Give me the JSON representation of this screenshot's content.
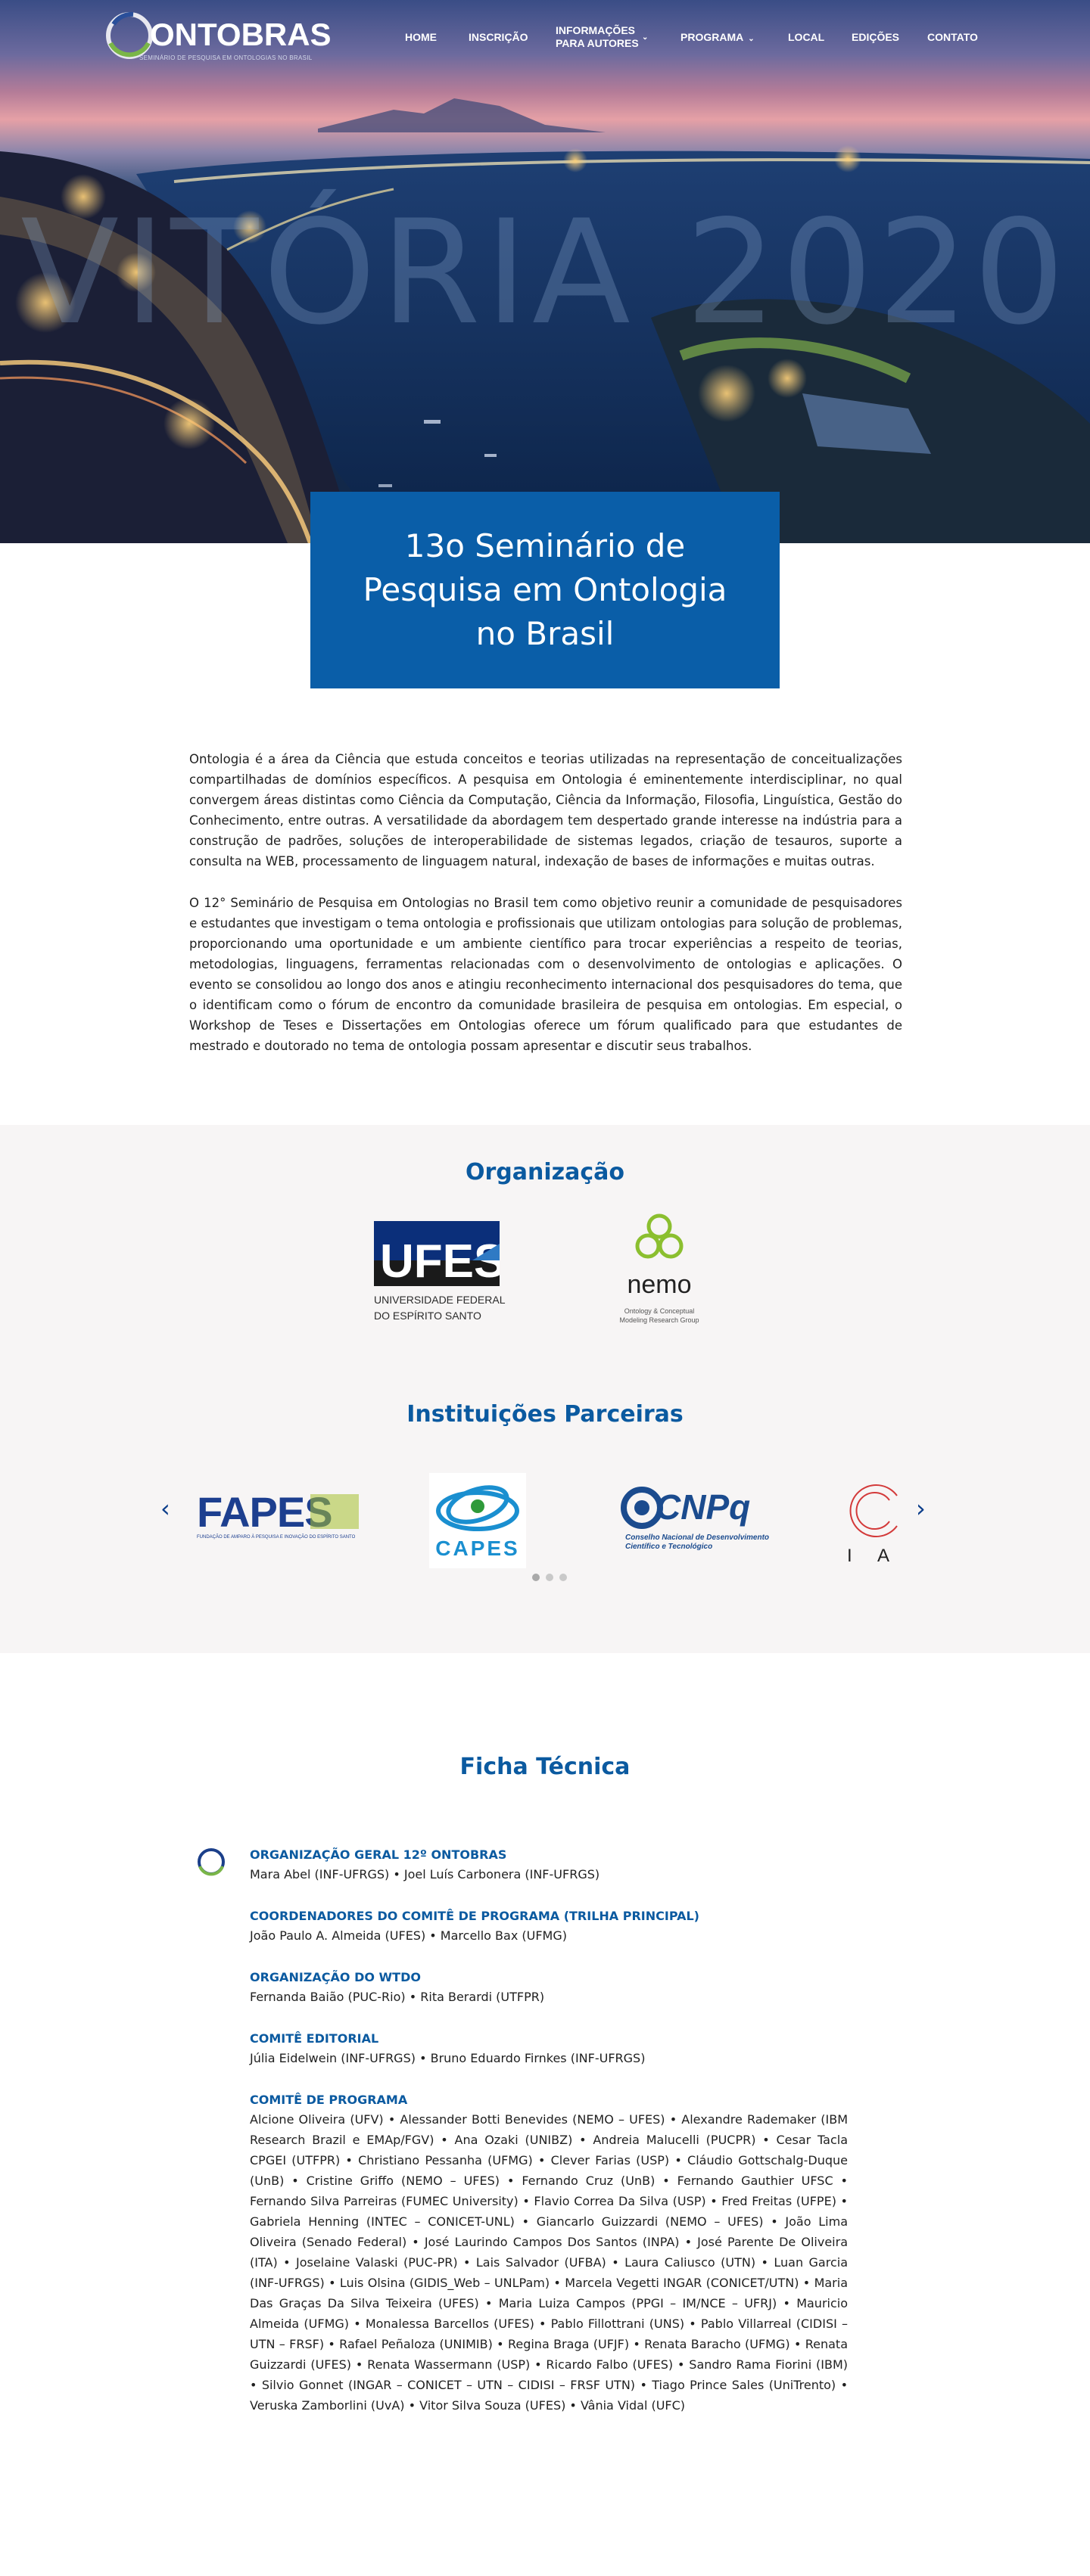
{
  "nav": {
    "brand": "ONTOBRAS",
    "tagline": "SEMINÁRIO DE PESQUISA EM ONTOLOGIAS NO BRASIL",
    "items": [
      {
        "label": "HOME"
      },
      {
        "label": "INSCRIÇÃO"
      },
      {
        "label_line1": "INFORMAÇÕES",
        "label_line2": "PARA AUTORES",
        "dropdown": true
      },
      {
        "label": "PROGRAMA",
        "dropdown": true
      },
      {
        "label": "LOCAL"
      },
      {
        "label": "EDIÇÕES"
      },
      {
        "label": "CONTATO"
      }
    ]
  },
  "hero": {
    "watermark": "VITÓRIA 2020",
    "title": "13o Seminário de Pesquisa em Ontologia no Brasil"
  },
  "intro": {
    "p1": "Ontologia é a área da Ciência que estuda conceitos e teorias utilizadas na representação de conceitualizações compartilhadas de domínios específicos. A pesquisa em Ontologia é eminentemente interdisciplinar, no qual convergem áreas distintas como Ciência da Computação, Ciência da Informação, Filosofia, Linguística, Gestão do Conhecimento, entre outras. A versatilidade da abordagem tem despertado grande interesse na indústria para a construção de padrões, soluções de interoperabilidade de sistemas legados, criação de tesauros, suporte a consulta na WEB, processamento de linguagem natural, indexação de bases de informações e muitas outras.",
    "p2": "O 12° Seminário de Pesquisa em Ontologias no Brasil tem como objetivo reunir a comunidade de pesquisadores e estudantes que investigam o tema ontologia e profissionais que utilizam ontologias para solução de problemas, proporcionando uma oportunidade e um ambiente científico para trocar experiências a respeito de teorias, metodologias, linguagens, ferramentas relacionadas com o desenvolvimento de ontologias e aplicações. O evento se consolidou ao longo dos anos e atingiu reconhecimento internacional dos pesquisadores do tema, que o identificam como o fórum de encontro da comunidade brasileira de pesquisa em ontologias. Em especial, o Workshop de Teses e Dissertações em Ontologias oferece um fórum qualificado para que estudantes de mestrado e doutorado no tema de ontologia possam apresentar e discutir seus trabalhos."
  },
  "organizacao": {
    "title": "Organização",
    "ufes": {
      "logo_text": "UFES",
      "caption_line1": "UNIVERSIDADE FEDERAL",
      "caption_line2": "DO ESPÍRITO SANTO"
    },
    "nemo": {
      "logo_text": "nemo",
      "sub_line1": "Ontology & Conceptual",
      "sub_line2": "Modeling Research Group"
    }
  },
  "parceiras": {
    "title": "Instituições Parceiras",
    "prev_icon": "chevron-left-icon",
    "next_icon": "chevron-right-icon",
    "logos": [
      {
        "text": "FAPES",
        "sub": "FUNDAÇÃO DE AMPARO À PESQUISA E INOVAÇÃO DO ESPÍRITO SANTO"
      },
      {
        "text": "CAPES"
      },
      {
        "text": "CNPq",
        "sub_line1": "Conselho Nacional de Desenvolvimento",
        "sub_line2": "Científico e Tecnológico"
      },
      {
        "text": "I A"
      }
    ],
    "dots": 3
  },
  "ficha": {
    "title": "Ficha Técnica",
    "groups": [
      {
        "heading": "ORGANIZAÇÃO GERAL 12º ONTOBRAS",
        "text": "Mara Abel (INF-UFRGS)  •  Joel Luís Carbonera (INF-UFRGS)"
      },
      {
        "heading": "COORDENADORES DO COMITÊ DE PROGRAMA (TRILHA PRINCIPAL)",
        "text": "João Paulo A. Almeida (UFES)  •  Marcello Bax (UFMG)"
      },
      {
        "heading": "ORGANIZAÇÃO DO WTDO",
        "text": "Fernanda Baião (PUC-Rio)  •  Rita Berardi (UTFPR)"
      },
      {
        "heading": "COMITÊ EDITORIAL",
        "text": "Júlia Eidelwein (INF-UFRGS)   •  Bruno Eduardo Firnkes (INF-UFRGS)"
      },
      {
        "heading": "COMITÊ DE PROGRAMA",
        "text": "Alcione Oliveira (UFV)  •  Alessander Botti Benevides (NEMO – UFES)  •  Alexandre Rademaker (IBM Research Brazil e EMAp/FGV)  •  Ana Ozaki (UNIBZ)  •  Andreia Malucelli (PUCPR)  •  Cesar Tacla CPGEI (UTFPR)  •  Christiano Pessanha (UFMG)  •  Clever Farias (USP)  •  Cláudio Gottschalg-Duque (UnB)  •  Cristine Griffo (NEMO – UFES)  •  Fernando Cruz (UnB)  •  Fernando Gauthier UFSC  •  Fernando Silva Parreiras (FUMEC University)  •  Flavio Correa Da Silva (USP)  •  Fred Freitas (UFPE)  •  Gabriela Henning (INTEC – CONICET-UNL)  •  Giancarlo Guizzardi (NEMO – UFES)  •  João Lima Oliveira (Senado Federal)  •  José Laurindo Campos Dos Santos (INPA)  •  José Parente De Oliveira (ITA)  •  Joselaine Valaski (PUC-PR)  •  Lais Salvador (UFBA)  •  Laura Caliusco (UTN)  •  Luan Garcia (INF-UFRGS)  •  Luis Olsina (GIDIS_Web – UNLPam)  •  Marcela Vegetti INGAR (CONICET/UTN)  •  Maria Das Graças Da Silva Teixeira (UFES)  •  Maria Luiza Campos (PPGI – IM/NCE – UFRJ)  •  Mauricio Almeida (UFMG)  •  Monalessa Barcellos (UFES)  •  Pablo Fillottrani (UNS)  •  Pablo Villarreal (CIDISI – UTN – FRSF)  •  Rafael Peñaloza (UNIMIB)  •  Regina Braga (UFJF)  •  Renata Baracho (UFMG)  •  Renata Guizzardi (UFES)  •  Renata Wassermann (USP)  •  Ricardo Falbo (UFES)  •  Sandro Rama Fiorini (IBM)  •  Silvio Gonnet (INGAR – CONICET – UTN – CIDISI – FRSF UTN)  •  Tiago Prince Sales (UniTrento)  •  Veruska Zamborlini (UvA)  •  Vitor Silva Souza (UFES)  •  Vânia Vidal (UFC)"
      }
    ]
  },
  "colors": {
    "primary_blue": "#0a5ea8",
    "heading_blue": "#0b5aa0",
    "section_bg": "#f7f5f5"
  }
}
